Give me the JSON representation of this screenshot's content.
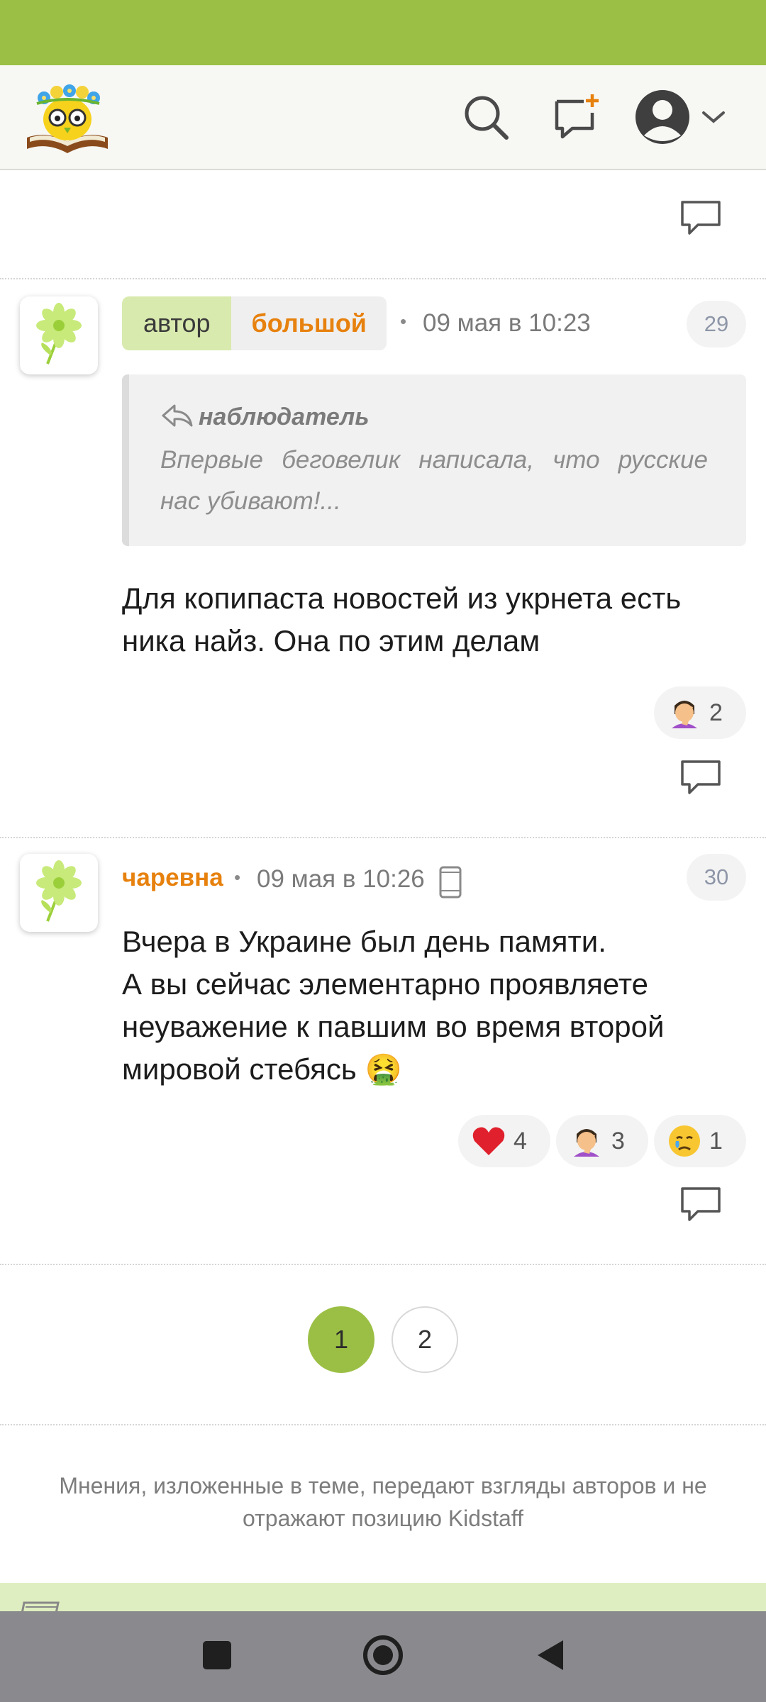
{
  "header": {
    "logo_icon": "kidstaff-owl-book-logo",
    "search_icon": "search-icon",
    "new_topic_icon": "new-message-icon",
    "profile_icon": "user-avatar-icon",
    "dropdown_icon": "chevron-down-icon"
  },
  "posts": [
    {
      "avatar_icon": "daisy-flower-icon",
      "tags": {
        "author": "автор",
        "username": "большой"
      },
      "date": "09 мая в 10:23",
      "number": "29",
      "quote": {
        "author": "наблюдатель",
        "text": "Впервые беговелик написала, что русские нас убивают!..."
      },
      "text": "Для копипаста новостей из укрнета есть ника найз. Она по этим делам",
      "reactions": [
        {
          "emoji": "facepalm",
          "count": "2"
        }
      ]
    },
    {
      "avatar_icon": "daisy-flower-icon",
      "username": "чаревна",
      "date": "09 мая в 10:26",
      "device_icon": "mobile-phone-icon",
      "number": "30",
      "text": "Вчера в Украине был день памяти.\nА вы сейчас элементарно проявляете неуважение к павшим во время второй мировой стебясь 🤮",
      "reactions": [
        {
          "emoji": "heart",
          "count": "4"
        },
        {
          "emoji": "facepalm",
          "count": "3"
        },
        {
          "emoji": "crying",
          "count": "1"
        }
      ]
    }
  ],
  "pagination": {
    "pages": [
      "1",
      "2"
    ],
    "current": "1"
  },
  "footer": {
    "disclaimer": "Мнения, изложенные в теме, передают взгляды авторов и не отражают позицию Kidstaff"
  },
  "colors": {
    "brand_green": "#9bbf45",
    "username_orange": "#e7810e",
    "author_tag_bg": "#d9eaaf"
  }
}
